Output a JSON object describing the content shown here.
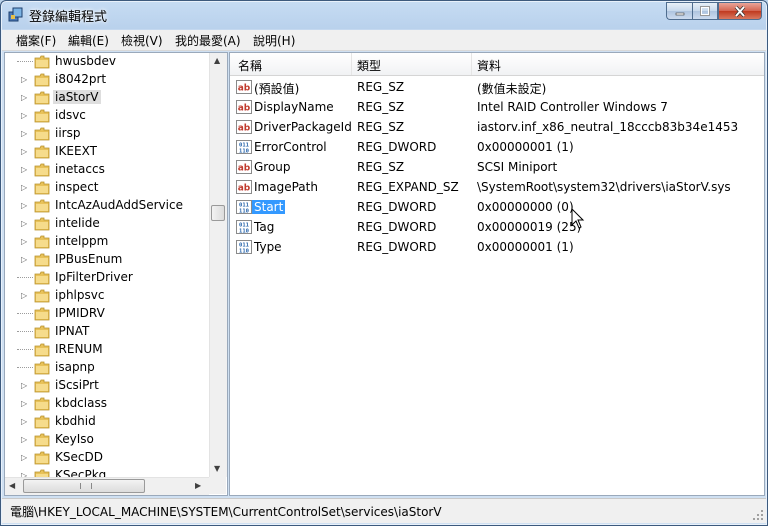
{
  "window": {
    "title": "登錄編輯程式"
  },
  "menu": [
    "檔案(F)",
    "編輯(E)",
    "檢視(V)",
    "我的最愛(A)",
    "說明(H)"
  ],
  "tree": [
    {
      "label": "hwusbdev",
      "expandable": false
    },
    {
      "label": "i8042prt",
      "expandable": true
    },
    {
      "label": "iaStorV",
      "expandable": true,
      "selected": true
    },
    {
      "label": "idsvc",
      "expandable": true
    },
    {
      "label": "iirsp",
      "expandable": true
    },
    {
      "label": "IKEEXT",
      "expandable": true
    },
    {
      "label": "inetaccs",
      "expandable": true
    },
    {
      "label": "inspect",
      "expandable": true
    },
    {
      "label": "IntcAzAudAddService",
      "expandable": true
    },
    {
      "label": "intelide",
      "expandable": true
    },
    {
      "label": "intelppm",
      "expandable": true
    },
    {
      "label": "IPBusEnum",
      "expandable": true
    },
    {
      "label": "IpFilterDriver",
      "expandable": false
    },
    {
      "label": "iphlpsvc",
      "expandable": true
    },
    {
      "label": "IPMIDRV",
      "expandable": false
    },
    {
      "label": "IPNAT",
      "expandable": false
    },
    {
      "label": "IRENUM",
      "expandable": false
    },
    {
      "label": "isapnp",
      "expandable": false
    },
    {
      "label": "iScsiPrt",
      "expandable": true
    },
    {
      "label": "kbdclass",
      "expandable": true
    },
    {
      "label": "kbdhid",
      "expandable": true
    },
    {
      "label": "KeyIso",
      "expandable": true
    },
    {
      "label": "KSecDD",
      "expandable": true
    },
    {
      "label": "KSecPkg",
      "expandable": true
    }
  ],
  "columns": {
    "name": "名稱",
    "type": "類型",
    "data": "資料"
  },
  "values": [
    {
      "icon": "ab",
      "name": "(預設值)",
      "type": "REG_SZ",
      "data": "(數值未設定)"
    },
    {
      "icon": "ab",
      "name": "DisplayName",
      "type": "REG_SZ",
      "data": "Intel RAID Controller Windows 7"
    },
    {
      "icon": "ab",
      "name": "DriverPackageId",
      "type": "REG_SZ",
      "data": "iastorv.inf_x86_neutral_18cccb83b34e1453"
    },
    {
      "icon": "bin",
      "name": "ErrorControl",
      "type": "REG_DWORD",
      "data": "0x00000001 (1)"
    },
    {
      "icon": "ab",
      "name": "Group",
      "type": "REG_SZ",
      "data": "SCSI Miniport"
    },
    {
      "icon": "ab",
      "name": "ImagePath",
      "type": "REG_EXPAND_SZ",
      "data": "\\SystemRoot\\system32\\drivers\\iaStorV.sys"
    },
    {
      "icon": "bin",
      "name": "Start",
      "type": "REG_DWORD",
      "data": "0x00000000 (0)",
      "selected": true
    },
    {
      "icon": "bin",
      "name": "Tag",
      "type": "REG_DWORD",
      "data": "0x00000019 (25)"
    },
    {
      "icon": "bin",
      "name": "Type",
      "type": "REG_DWORD",
      "data": "0x00000001 (1)"
    }
  ],
  "status": {
    "path": "電腦\\HKEY_LOCAL_MACHINE\\SYSTEM\\CurrentControlSet\\services\\iaStorV"
  },
  "colors": {
    "selection": "#3399ff",
    "tree_selection": "#dedede",
    "folder": "#e8c25a",
    "ab_icon": "#c0392b",
    "bin_icon": "#1f5fa8"
  }
}
